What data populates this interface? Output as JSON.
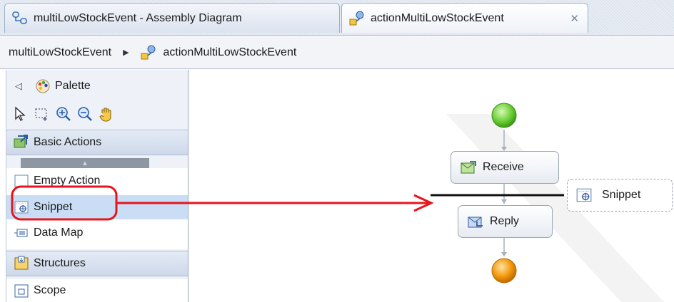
{
  "tabs": [
    {
      "label": "multiLowStockEvent - Assembly Diagram",
      "icon": "assembly-diagram-icon",
      "active": false
    },
    {
      "label": "actionMultiLowStockEvent",
      "icon": "process-icon",
      "active": true,
      "close": "✕"
    }
  ],
  "breadcrumb": {
    "root": "multiLowStockEvent",
    "separator": "▶",
    "current": "actionMultiLowStockEvent"
  },
  "palette": {
    "collapse_glyph": "◁",
    "title": "Palette",
    "tools": [
      "select-arrow-icon",
      "marquee-select-icon",
      "zoom-in-icon",
      "zoom-out-icon",
      "hand-icon"
    ],
    "drawers": {
      "basic_actions": "Basic Actions",
      "structures": "Structures"
    },
    "scroll_glyph": "▲",
    "items": [
      {
        "label": "Empty Action",
        "icon": "empty-action-icon"
      },
      {
        "label": "Snippet",
        "icon": "snippet-icon",
        "selected": true
      },
      {
        "label": "Data Map",
        "icon": "data-map-icon"
      },
      {
        "label": "Scope",
        "icon": "scope-icon"
      }
    ]
  },
  "canvas": {
    "nodes": {
      "receive": "Receive",
      "reply": "Reply",
      "snippet_drag": "Snippet"
    }
  },
  "colors": {
    "annotation": "#e8141c",
    "start": "#6fd23a",
    "end": "#f39a0c",
    "selection": "#c9def5"
  }
}
